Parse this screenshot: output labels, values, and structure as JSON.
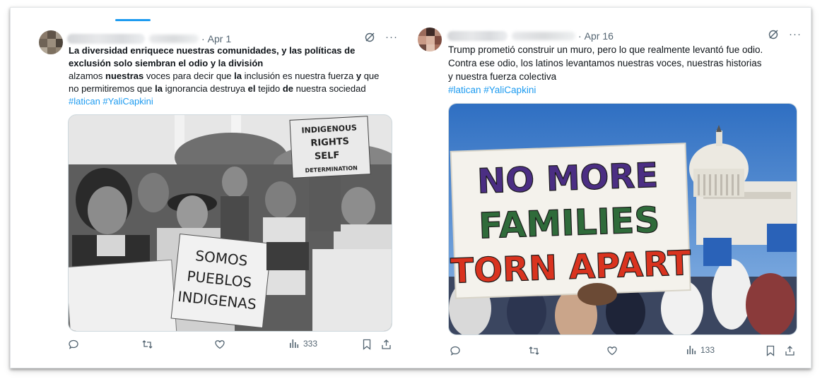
{
  "tweets": [
    {
      "date": "Apr 1",
      "separator": "·",
      "text_bold": "La diversidad enriquece nuestras comunidades, y las políticas de exclusión solo siembran el odio y la división",
      "text_line2a": "alzamos ",
      "text_line2b": "nuestras",
      "text_line2c": " voces para decir que ",
      "text_line2d": "la",
      "text_line2e": " inclusión es nuestra fuerza ",
      "text_line2f": "y",
      "text_line2g": " que",
      "text_line3a": "no permitiremos que ",
      "text_line3b": "la",
      "text_line3c": " ignorancia destruya ",
      "text_line3d": "el",
      "text_line3e": " tejido ",
      "text_line3f": "de",
      "text_line3g": " nuestra sociedad",
      "hashtags": "#latican #YaliCapkini",
      "image_signs": [
        "INDIGENOUS",
        "RIGHTS",
        "SELF",
        "DETERMINATION",
        "SOMOS",
        "PUEBLOS",
        "INDIGENAS"
      ],
      "views": "333"
    },
    {
      "date": "Apr 16",
      "separator": "·",
      "text_line1": "Trump prometió construir un muro, pero lo que realmente levantó fue odio.",
      "text_line2": "Contra ese odio, los latinos levantamos nuestras voces, nuestras historias",
      "text_line3": "y nuestra fuerza colectiva",
      "hashtags": "#latican #YaliCapkini",
      "image_sign": [
        "NO MORE",
        "FAMILIES",
        "TORN APART"
      ],
      "views": "133"
    }
  ],
  "icons": [
    "reply-icon",
    "retweet-icon",
    "like-icon",
    "views-icon",
    "bookmark-icon",
    "share-icon",
    "grok-icon",
    "more-icon"
  ],
  "colors": {
    "accent": "#1d9bf0",
    "text": "#0f1419",
    "muted": "#536471",
    "sign_purple": "#4b2e83",
    "sign_green": "#2f6b3a",
    "sign_red": "#d9331f"
  }
}
